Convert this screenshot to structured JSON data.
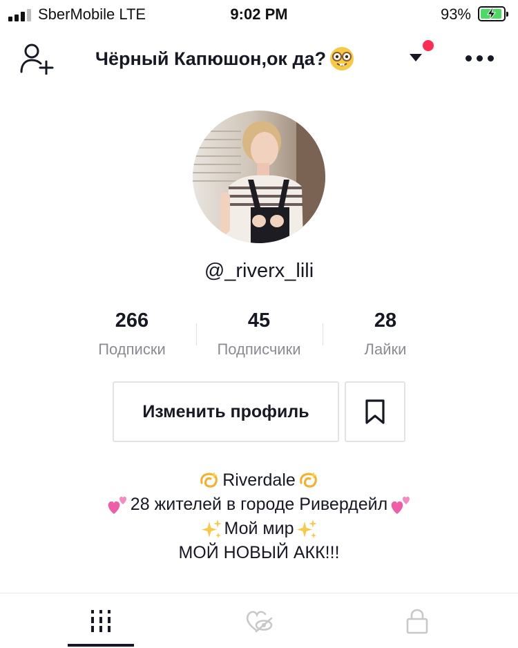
{
  "status_bar": {
    "carrier": "SberMobile  LTE",
    "time": "9:02 PM",
    "battery_percent": "93%",
    "battery_level": 0.93,
    "charging": true
  },
  "header": {
    "title": "Чёрный Капюшон,ок да?",
    "title_emoji": "nerd-face-icon",
    "has_notification_dot": true,
    "notification_dot_color": "#fe2c55"
  },
  "profile": {
    "username": "@_riverx_lili",
    "stats": [
      {
        "value": "266",
        "label": "Подписки"
      },
      {
        "value": "45",
        "label": "Подписчики"
      },
      {
        "value": "28",
        "label": "Лайки"
      }
    ],
    "edit_profile_label": "Изменить профиль",
    "bio": {
      "line1": "Riverdale",
      "line2": "28 жителей в городе Ривердейл",
      "line3": "Мой мир",
      "line4": "МОЙ НОВЫЙ АКК!!!"
    }
  },
  "tabs": [
    {
      "icon": "grid-icon",
      "active": true
    },
    {
      "icon": "liked-heart-hidden-icon",
      "active": false
    },
    {
      "icon": "lock-icon",
      "active": false
    }
  ],
  "colors": {
    "text": "#161823",
    "secondary_text": "#8a8b91",
    "accent": "#fe2c55",
    "border": "#e3e3e4",
    "battery_fill": "#4cd964"
  }
}
